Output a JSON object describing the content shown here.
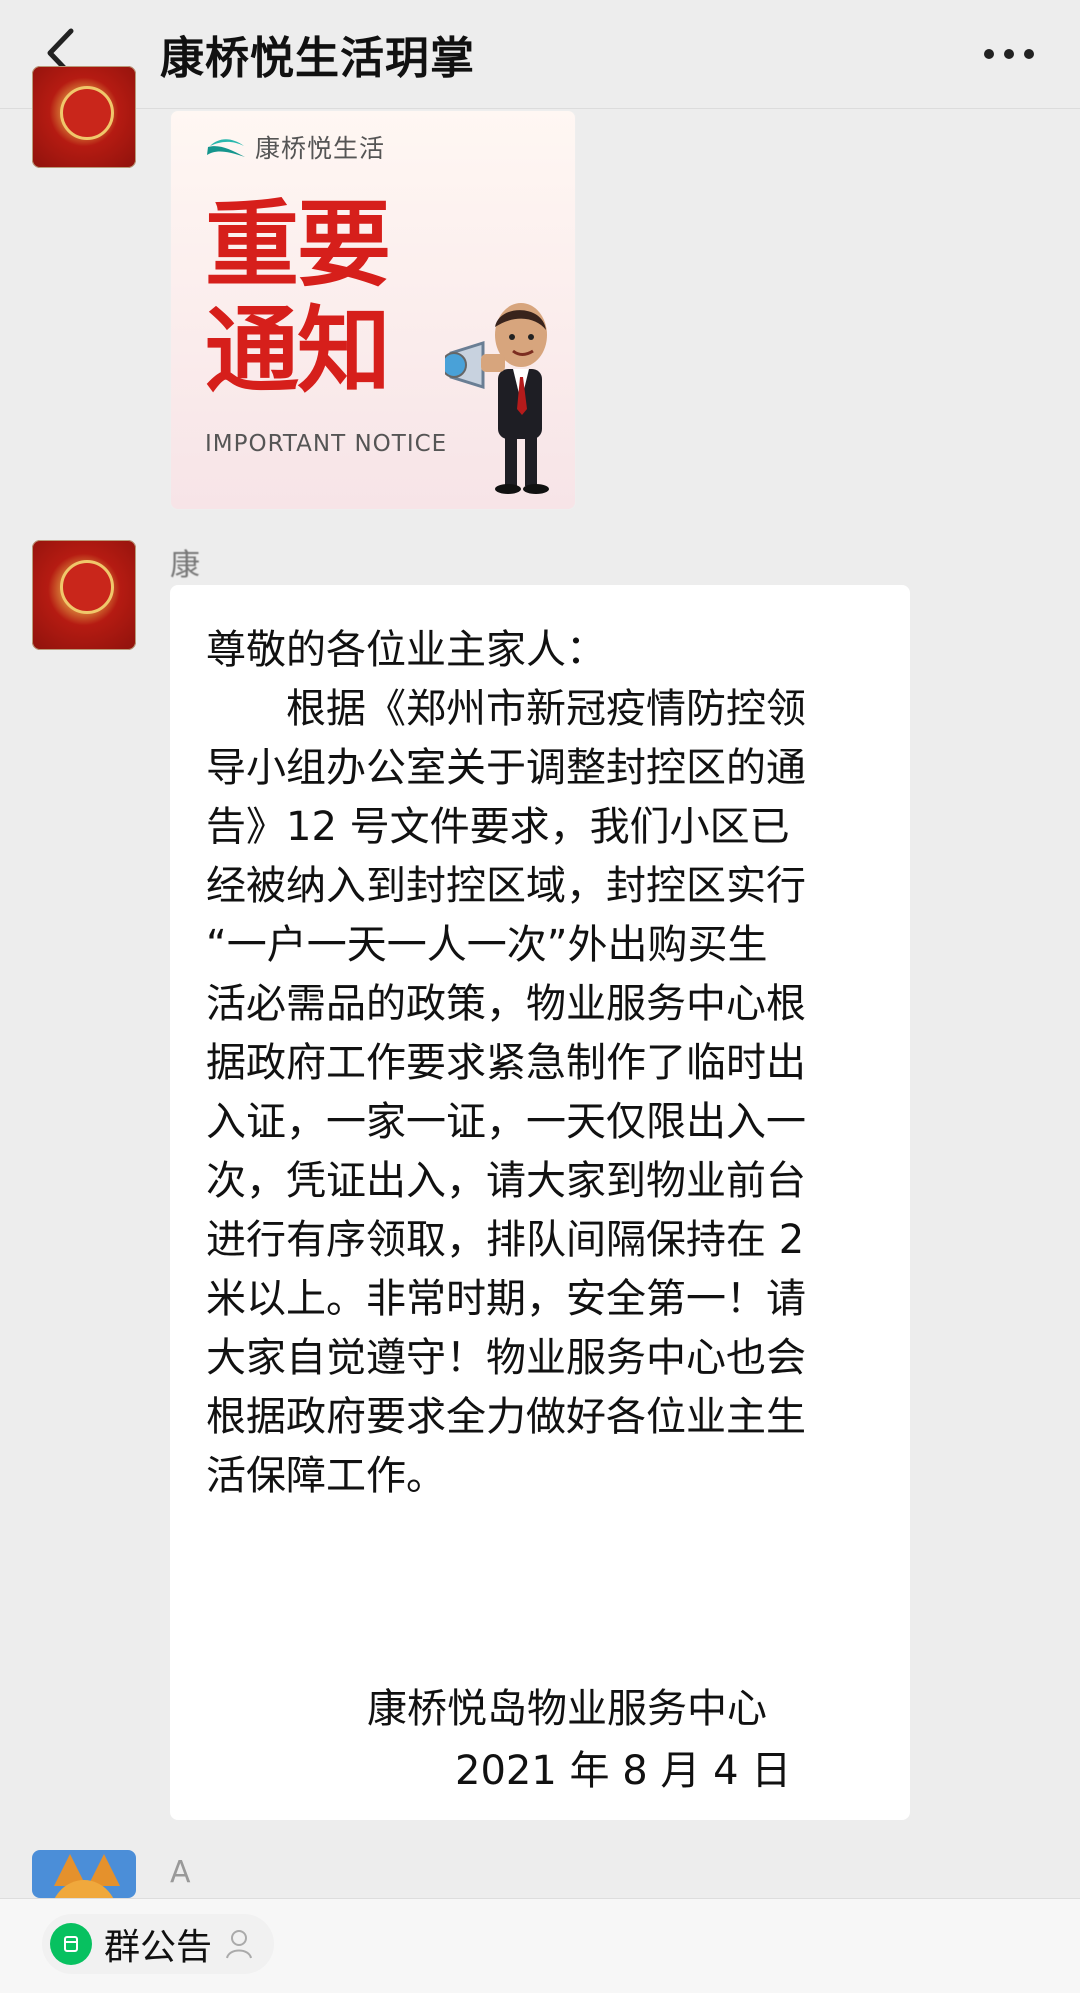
{
  "window": {
    "title": "康桥悦生活玥掌"
  },
  "icons": {
    "back": "chevron-left-icon",
    "more": "more-dots-icon",
    "announcement": "announcement-icon",
    "person": "person-icon"
  },
  "colors": {
    "background": "#ededed",
    "bubble": "#ffffff",
    "notice_red": "#d61f1b",
    "accent_green": "#07c160"
  },
  "messages": [
    {
      "type": "image",
      "brand_name": "康桥悦生活",
      "headline": "重要\n通知",
      "subheadline": "IMPORTANT NOTICE"
    },
    {
      "type": "text",
      "sender_name": "康",
      "lines": [
        "尊敬的各位业主家人：",
        "　　根据《郑州市新冠疫情防控领",
        "导小组办公室关于调整封控区的通",
        "告》12 号文件要求，我们小区已",
        "经被纳入到封控区域，封控区实行",
        "“一户一天一人一次”外出购买生",
        "活必需品的政策，物业服务中心根",
        "据政府工作要求紧急制作了临时出",
        "入证，一家一证，一天仅限出入一",
        "次，凭证出入，请大家到物业前台",
        "进行有序领取，排队间隔保持在 2",
        "米以上。非常时期，安全第一！请",
        "大家自觉遵守！物业服务中心也会",
        "根据政府要求全力做好各位业主生",
        "活保障工作。"
      ],
      "signature_org": "康桥悦岛物业服务中心",
      "signature_date": "2021 年 8 月 4 日"
    },
    {
      "type": "partial",
      "sender_name": "A"
    }
  ],
  "bottom": {
    "announcement_label": "群公告"
  }
}
